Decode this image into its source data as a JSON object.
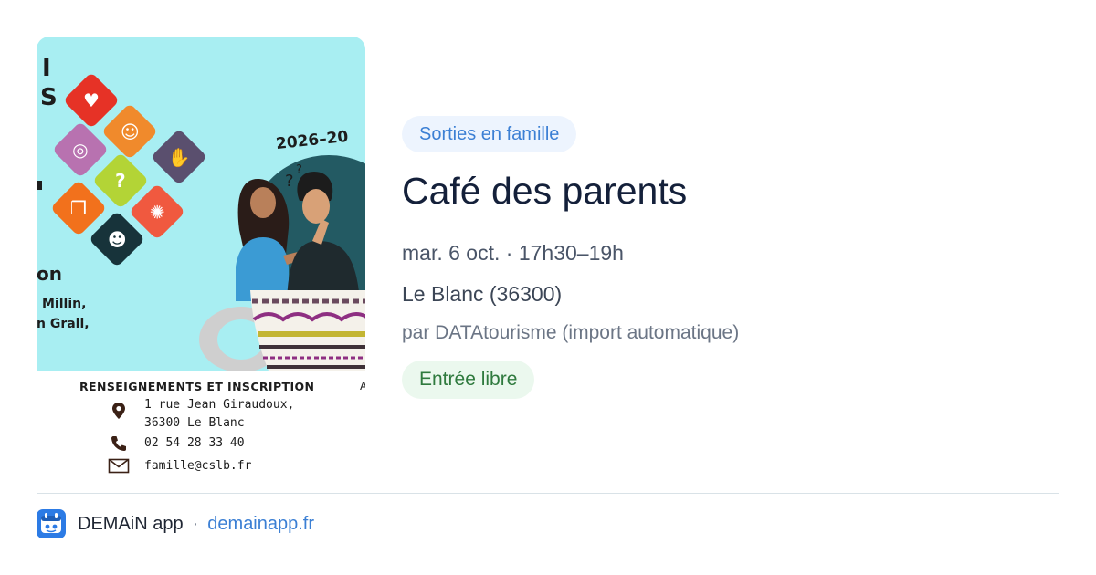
{
  "poster": {
    "year_text": "2026–20",
    "fragments": [
      "I",
      "S",
      "on",
      "Millin,",
      "n Grall,"
    ],
    "info_heading": "RENSEIGNEMENTS ET INSCRIPTION",
    "info_heading_tail": "A",
    "address_line1": "1 rue Jean Giraudoux,",
    "address_line2": "36300 Le Blanc",
    "phone": "02 54 28 33 40",
    "email": "famille@cslb.fr",
    "tile_glyph": "?"
  },
  "event": {
    "category": "Sorties en famille",
    "title": "Café des parents",
    "date": "mar. 6 oct. · 17h30–19h",
    "place": "Le Blanc (36300)",
    "source": "par DATAtourisme (import automatique)",
    "price": "Entrée libre"
  },
  "footer": {
    "app_name": "DEMAiN app",
    "separator": "·",
    "link": "demainapp.fr"
  },
  "colors": {
    "poster_background": "#a8eef2",
    "category_background": "#edf4fe",
    "category_text": "#3b7fd4",
    "price_background": "#ebf8ee",
    "price_text": "#2f7a3e",
    "link": "#3b7fd4",
    "app_icon": "#2c7be5"
  },
  "icons": {
    "poster_location": "map-pin-icon",
    "poster_phone": "phone-icon",
    "poster_email": "envelope-icon",
    "app": "demain-app-icon"
  }
}
